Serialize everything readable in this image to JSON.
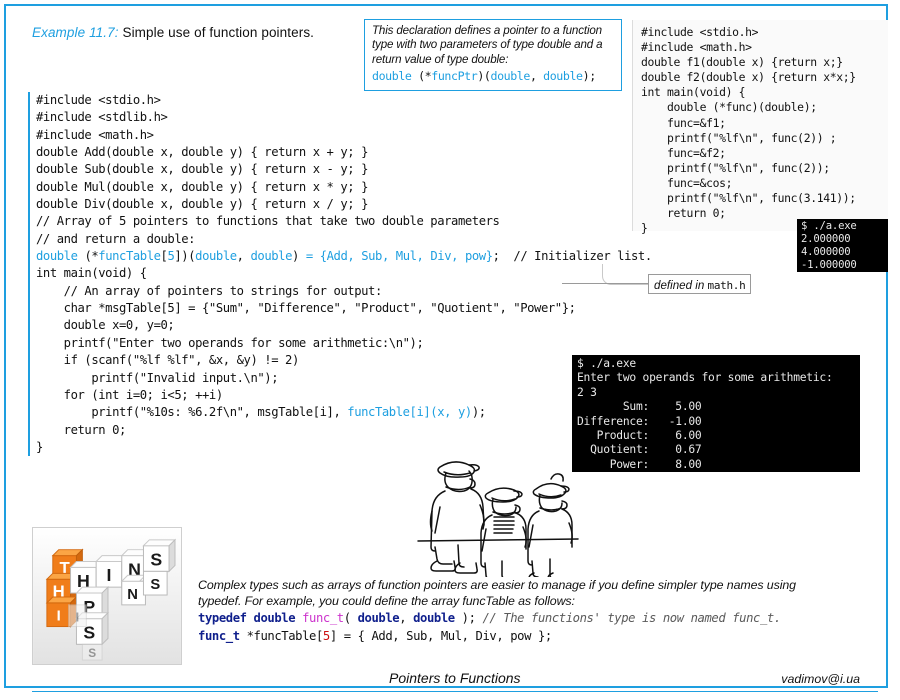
{
  "title": {
    "example_label": "Example 11.7:",
    "description": " Simple use of function pointers."
  },
  "declaration_callout": {
    "line1": "This declaration defines a pointer to a function",
    "line2": "type with two parameters of type double and a",
    "line3": "return value of type double:",
    "code": "double (*funcPtr)(double, double);"
  },
  "top_right_panel": {
    "lines": [
      "#include <stdio.h>",
      "#include <math.h>",
      "double f1(double x) {return x;}",
      "double f2(double x) {return x*x;}",
      "int main(void) {",
      "    double (*func)(double);",
      "    func=&f1;",
      "    printf(\"%lf\\n\", func(2)) ;",
      "    func=&f2;",
      "    printf(\"%lf\\n\", func(2));",
      "    func=&cos;",
      "    printf(\"%lf\\n\", func(3.141));",
      "    return 0;",
      "}"
    ]
  },
  "terminal_small": {
    "lines": [
      "$ ./a.exe",
      "2.000000",
      "4.000000",
      "-1.000000"
    ]
  },
  "main_code": {
    "lines": [
      "#include <stdio.h>",
      "#include <stdlib.h>",
      "#include <math.h>",
      "double Add(double x, double y) { return x + y; }",
      "double Sub(double x, double y) { return x - y; }",
      "double Mul(double x, double y) { return x * y; }",
      "double Div(double x, double y) { return x / y; }",
      "// Array of 5 pointers to functions that take two double parameters",
      "// and return a double:",
      "double (*funcTable[5])(double, double) = {Add, Sub, Mul, Div, pow};  // Initializer list.",
      "int main(void) {",
      "    // An array of pointers to strings for output:",
      "    char *msgTable[5] = {\"Sum\", \"Difference\", \"Product\", \"Quotient\", \"Power\"};",
      "    double x=0, y=0;",
      "    printf(\"Enter two operands for some arithmetic:\\n\");",
      "    if (scanf(\"%lf %lf\", &x, &y) != 2)",
      "        printf(\"Invalid input.\\n\");",
      "    for (int i=0; i<5; ++i)",
      "        printf(\"%10s: %6.2f\\n\", msgTable[i], funcTable[i](x, y));",
      "    return 0;",
      "}"
    ]
  },
  "math_callout": {
    "text": "defined in ",
    "mono": "math.h"
  },
  "terminal_big": {
    "lines": [
      "$ ./a.exe",
      "Enter two operands for some arithmetic:",
      "2 3",
      "       Sum:    5.00",
      "Difference:   -1.00",
      "   Product:    6.00",
      "  Quotient:    0.67",
      "     Power:    8.00"
    ]
  },
  "hints": {
    "image_words": [
      "HINTS",
      "TIPS"
    ],
    "paragraph_line1": "Complex types such as arrays of function pointers are easier to manage if you define simpler type names using",
    "paragraph_line2": "typedef. For example, you could define the array funcTable as follows:",
    "code_line1_a": "typedef double ",
    "code_line1_b": "func_t",
    "code_line1_c": "( ",
    "code_line1_d": "double",
    "code_line1_e": ", ",
    "code_line1_f": "double",
    "code_line1_g": " ); ",
    "code_line1_h": "// The functions' type is now named func_t.",
    "code_line2_a": "func_t",
    "code_line2_b": " *funcTable[",
    "code_line2_c": "5",
    "code_line2_d": "] = { Add, Sub, Mul, Div, pow };"
  },
  "footer": {
    "title": "Pointers to Functions",
    "email": "vadimov@i.ua"
  },
  "colors": {
    "accent_blue": "#1e9fe0",
    "code_blue": "#1e9fe0",
    "terminal_bg": "#000000",
    "terminal_fg": "#e8e8e8",
    "keyword_navy": "#0f1f8c",
    "type_magenta": "#cc33cc",
    "number_red": "#cc1111"
  }
}
